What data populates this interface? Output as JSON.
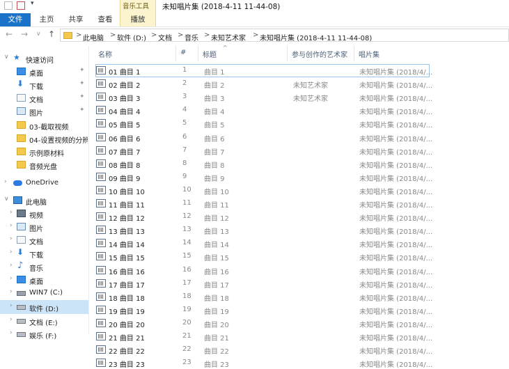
{
  "window": {
    "title": "未知唱片集 (2018-4-11 11-44-08)",
    "context_tab_group": "音乐工具"
  },
  "ribbon": {
    "tabs": [
      "文件",
      "主页",
      "共享",
      "查看",
      "播放"
    ]
  },
  "address": {
    "crumbs": [
      "此电脑",
      "软件 (D:)",
      "文档",
      "音乐",
      "未知艺术家",
      "未知唱片集 (2018-4-11 11-44-08)"
    ],
    "separator": ">"
  },
  "nav": {
    "quick_access_label": "快速访问",
    "quick_items": [
      {
        "label": "桌面",
        "icon": "desktop-icon",
        "pinned": true
      },
      {
        "label": "下载",
        "icon": "download-icon",
        "pinned": true
      },
      {
        "label": "文档",
        "icon": "document-icon",
        "pinned": true
      },
      {
        "label": "图片",
        "icon": "picture-icon",
        "pinned": true
      },
      {
        "label": "03-截取视频",
        "icon": "folder-icon",
        "pinned": false
      },
      {
        "label": "04-设置视频的分辨",
        "icon": "folder-icon",
        "pinned": false
      },
      {
        "label": "示例原材料",
        "icon": "folder-icon",
        "pinned": false
      },
      {
        "label": "音频光盘",
        "icon": "folder-icon",
        "pinned": false
      }
    ],
    "onedrive_label": "OneDrive",
    "this_pc_label": "此电脑",
    "pc_items": [
      {
        "label": "视频",
        "icon": "video-icon"
      },
      {
        "label": "图片",
        "icon": "picture-icon"
      },
      {
        "label": "文档",
        "icon": "document-icon"
      },
      {
        "label": "下载",
        "icon": "download-icon"
      },
      {
        "label": "音乐",
        "icon": "music-icon"
      },
      {
        "label": "桌面",
        "icon": "desktop-icon"
      },
      {
        "label": "WIN7 (C:)",
        "icon": "drive-icon"
      },
      {
        "label": "软件 (D:)",
        "icon": "drive-icon",
        "selected": true
      },
      {
        "label": "文档 (E:)",
        "icon": "drive-icon"
      },
      {
        "label": "娱乐 (F:)",
        "icon": "drive-icon"
      }
    ]
  },
  "columns": {
    "name": "名称",
    "number": "#",
    "title": "标题",
    "artists": "参与创作的艺术家",
    "album": "唱片集"
  },
  "files": [
    {
      "name": "01 曲目 1",
      "num": "1",
      "title": "曲目 1",
      "artist": "",
      "album": "未知唱片集 (2018/4/..."
    },
    {
      "name": "02 曲目 2",
      "num": "2",
      "title": "曲目 2",
      "artist": "未知艺术家",
      "album": "未知唱片集 (2018/4/..."
    },
    {
      "name": "03 曲目 3",
      "num": "3",
      "title": "曲目 3",
      "artist": "未知艺术家",
      "album": "未知唱片集 (2018/4/..."
    },
    {
      "name": "04 曲目 4",
      "num": "4",
      "title": "曲目 4",
      "artist": "",
      "album": "未知唱片集 (2018/4/..."
    },
    {
      "name": "05 曲目 5",
      "num": "5",
      "title": "曲目 5",
      "artist": "",
      "album": "未知唱片集 (2018/4/..."
    },
    {
      "name": "06 曲目 6",
      "num": "6",
      "title": "曲目 6",
      "artist": "",
      "album": "未知唱片集 (2018/4/..."
    },
    {
      "name": "07 曲目 7",
      "num": "7",
      "title": "曲目 7",
      "artist": "",
      "album": "未知唱片集 (2018/4/..."
    },
    {
      "name": "08 曲目 8",
      "num": "8",
      "title": "曲目 8",
      "artist": "",
      "album": "未知唱片集 (2018/4/..."
    },
    {
      "name": "09 曲目 9",
      "num": "9",
      "title": "曲目 9",
      "artist": "",
      "album": "未知唱片集 (2018/4/..."
    },
    {
      "name": "10 曲目 10",
      "num": "10",
      "title": "曲目 10",
      "artist": "",
      "album": "未知唱片集 (2018/4/..."
    },
    {
      "name": "11 曲目 11",
      "num": "11",
      "title": "曲目 11",
      "artist": "",
      "album": "未知唱片集 (2018/4/..."
    },
    {
      "name": "12 曲目 12",
      "num": "12",
      "title": "曲目 12",
      "artist": "",
      "album": "未知唱片集 (2018/4/..."
    },
    {
      "name": "13 曲目 13",
      "num": "13",
      "title": "曲目 13",
      "artist": "",
      "album": "未知唱片集 (2018/4/..."
    },
    {
      "name": "14 曲目 14",
      "num": "14",
      "title": "曲目 14",
      "artist": "",
      "album": "未知唱片集 (2018/4/..."
    },
    {
      "name": "15 曲目 15",
      "num": "15",
      "title": "曲目 15",
      "artist": "",
      "album": "未知唱片集 (2018/4/..."
    },
    {
      "name": "16 曲目 16",
      "num": "16",
      "title": "曲目 16",
      "artist": "",
      "album": "未知唱片集 (2018/4/..."
    },
    {
      "name": "17 曲目 17",
      "num": "17",
      "title": "曲目 17",
      "artist": "",
      "album": "未知唱片集 (2018/4/..."
    },
    {
      "name": "18 曲目 18",
      "num": "18",
      "title": "曲目 18",
      "artist": "",
      "album": "未知唱片集 (2018/4/..."
    },
    {
      "name": "19 曲目 19",
      "num": "19",
      "title": "曲目 19",
      "artist": "",
      "album": "未知唱片集 (2018/4/..."
    },
    {
      "name": "20 曲目 20",
      "num": "20",
      "title": "曲目 20",
      "artist": "",
      "album": "未知唱片集 (2018/4/..."
    },
    {
      "name": "21 曲目 21",
      "num": "21",
      "title": "曲目 21",
      "artist": "",
      "album": "未知唱片集 (2018/4/..."
    },
    {
      "name": "22 曲目 22",
      "num": "22",
      "title": "曲目 22",
      "artist": "",
      "album": "未知唱片集 (2018/4/..."
    },
    {
      "name": "23 曲目 23",
      "num": "23",
      "title": "曲目 23",
      "artist": "",
      "album": "未知唱片集 (2018/4/..."
    }
  ],
  "colors": {
    "file_tab": "#1a73c9",
    "context_tab": "#fbf4cf",
    "selection": "#cce4f7",
    "folder": "#f2c94c"
  }
}
